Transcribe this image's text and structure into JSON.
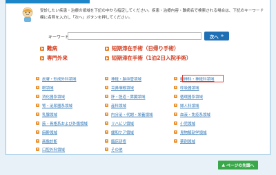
{
  "intro_text": "受診したい疾患・治療の領域を下記の中から指定してください。疾患・治療内容・難病名で検索される場合は、下記のキーワード欄に名称を入力し「次へ」ボタンを押してください。",
  "keyword": {
    "label": "キーワード：",
    "value": "",
    "placeholder": ""
  },
  "next_button": "次へ",
  "headings": [
    "難病",
    "専門外来",
    "短期滞在手術（日帰り手術）",
    "短期滞在手術（1泊2日入院手術）"
  ],
  "columns": [
    [
      "皮膚・形成外科領域",
      "眼領域",
      "消化器系領域",
      "腎・泌尿器系領域",
      "乳腺領域",
      "筋・骨格系および外傷領域",
      "麻酔領域",
      "画像診断",
      "口腔外科領域"
    ],
    [
      "神経・脳血管領域",
      "耳鼻咽喉領域",
      "肝・胆道・膵臓領域",
      "産科領域",
      "内分泌・代謝・栄養領域",
      "リハビリ領域",
      "緩和ケア領域",
      "臨床研修",
      "その他"
    ],
    [
      "精神科・神経科領域",
      "呼吸器領域",
      "循環器系領域",
      "婦人科領域",
      "血液・免疫系領域",
      "小児領域",
      "見物解剖学領域",
      "薬剤領域"
    ]
  ],
  "page_top_button": "ページの先頭へ",
  "colors": {
    "accent_blue": "#1f6fb5",
    "heading_red": "#d03a1c",
    "link_blue": "#2f76b6",
    "green": "#3aa84a",
    "highlight": "#e03a2a"
  }
}
